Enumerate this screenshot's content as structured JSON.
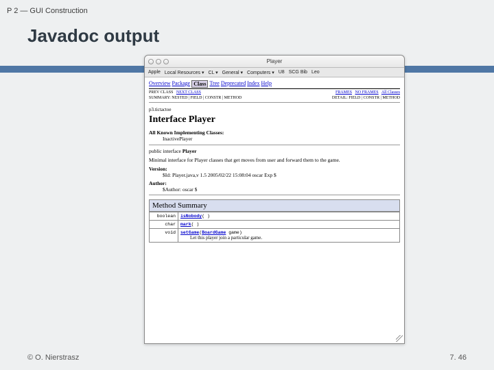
{
  "slide": {
    "header": "P 2 — GUI Construction",
    "title": "Javadoc output",
    "copyright": "© O. Nierstrasz",
    "pagenum": "7. 46"
  },
  "browser": {
    "title": "Player",
    "toolbar": [
      "Apple",
      "Local Resources ▾",
      "CL ▾",
      "General ▾",
      "Computers ▾",
      "U8",
      "SCG Bib",
      "Leo"
    ],
    "nav": {
      "items": [
        "Overview",
        "Package",
        "Class",
        "Tree",
        "Deprecated",
        "Index",
        "Help"
      ],
      "active": "Class"
    },
    "subnav_left": {
      "prev": "PREV CLASS",
      "next": "NEXT CLASS"
    },
    "subnav_right": {
      "frames": "FRAMES",
      "noframes": "NO FRAMES",
      "all": "All Classes"
    },
    "summary_left": "SUMMARY: NESTED | FIELD | CONSTR | METHOD",
    "summary_right": "DETAIL: FIELD | CONSTR | METHOD",
    "pkg": "p3.tictactoe",
    "iface_label": "Interface Player",
    "known_label": "All Known Implementing Classes:",
    "known_value": "InactivePlayer",
    "sig_prefix": "public interface ",
    "sig_name": "Player",
    "description": "Minimal interface for Player classes that get moves from user and forward them to the game.",
    "version_label": "Version:",
    "version_value": "$Id: Player.java,v 1.5 2005/02/22 15:08:04 oscar Exp $",
    "author_label": "Author:",
    "author_value": "$Author: oscar $",
    "method_summary_header": "Method Summary",
    "methods": [
      {
        "ret": "boolean",
        "name": "isNobody",
        "args": "( )",
        "desc": ""
      },
      {
        "ret": "char",
        "name": "mark",
        "args": "( )",
        "desc": ""
      },
      {
        "ret": "void",
        "name": "setGame",
        "args_pre": "(",
        "arg_type": "BoardGame",
        "arg_name": " game)",
        "desc": "Let this player join a particular game."
      }
    ]
  }
}
